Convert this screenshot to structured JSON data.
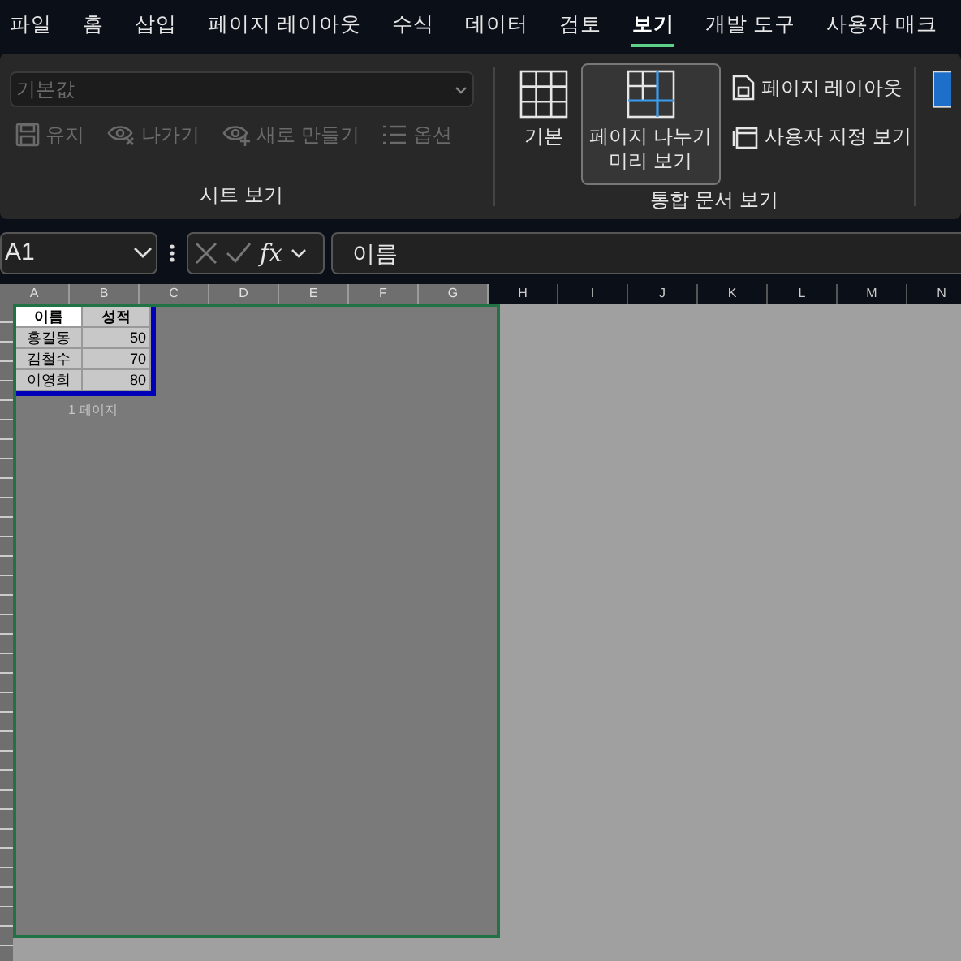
{
  "menu_tabs": [
    {
      "label": "파일",
      "selected": false
    },
    {
      "label": "홈",
      "selected": false
    },
    {
      "label": "삽입",
      "selected": false
    },
    {
      "label": "페이지 레이아웃",
      "selected": false
    },
    {
      "label": "수식",
      "selected": false
    },
    {
      "label": "데이터",
      "selected": false
    },
    {
      "label": "검토",
      "selected": false
    },
    {
      "label": "보기",
      "selected": true
    },
    {
      "label": "개발 도구",
      "selected": false
    },
    {
      "label": "사용자 매크",
      "selected": false
    }
  ],
  "ribbon": {
    "sheet_view": {
      "dropdown": {
        "value": "기본값",
        "disabled": true
      },
      "buttons": [
        {
          "label": "유지",
          "disabled": true
        },
        {
          "label": "나가기",
          "disabled": true
        },
        {
          "label": "새로 만들기",
          "disabled": true
        },
        {
          "label": "옵션",
          "disabled": true
        }
      ],
      "group_label": "시트 보기"
    },
    "workbook_views": {
      "large_buttons": [
        {
          "label": "기본",
          "selected": false
        },
        {
          "label": "페이지 나누기 미리 보기",
          "selected": true
        }
      ],
      "small_buttons": [
        {
          "label": "페이지 레이아웃"
        },
        {
          "label": "사용자 지정 보기"
        }
      ],
      "group_label": "통합 문서 보기"
    }
  },
  "formula_bar": {
    "name_box": "A1",
    "fx": "fx",
    "value": "이름"
  },
  "columns": [
    {
      "label": "A",
      "in_print_area": true
    },
    {
      "label": "B",
      "in_print_area": true
    },
    {
      "label": "C",
      "in_print_area": true
    },
    {
      "label": "D",
      "in_print_area": true
    },
    {
      "label": "E",
      "in_print_area": true
    },
    {
      "label": "F",
      "in_print_area": true
    },
    {
      "label": "G",
      "in_print_area": true
    },
    {
      "label": "H",
      "in_print_area": false
    },
    {
      "label": "I",
      "in_print_area": false
    },
    {
      "label": "J",
      "in_print_area": false
    },
    {
      "label": "K",
      "in_print_area": false
    },
    {
      "label": "L",
      "in_print_area": false
    },
    {
      "label": "M",
      "in_print_area": false
    },
    {
      "label": "N",
      "in_print_area": false
    }
  ],
  "table": [
    [
      "이름",
      "성적"
    ],
    [
      "홍길동",
      "50"
    ],
    [
      "김철수",
      "70"
    ],
    [
      "이영희",
      "80"
    ]
  ],
  "page_label": "1 페이지"
}
